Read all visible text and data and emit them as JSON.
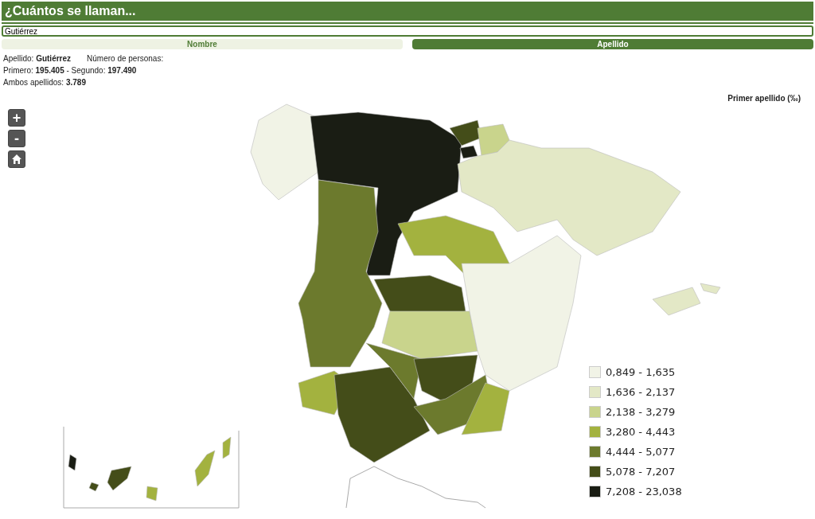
{
  "header": {
    "title": "¿Cuántos se llaman..."
  },
  "search": {
    "value": "Gutiérrez"
  },
  "tabs": [
    {
      "label": "Nombre",
      "selected": false
    },
    {
      "label": "Apellido",
      "selected": true
    }
  ],
  "info": {
    "line_1": "Apellido: **Gutiérrez**",
    "line_1b": "Número de personas:",
    "line_2": "Primero: **195.405** - Segundo: **197.490**",
    "line_3": "Ambos apellidos: **3.789**"
  },
  "map": {
    "title": "Primer apellido (‰)",
    "zoom_in": "+",
    "zoom_out": "-",
    "legend": [
      {
        "label": "0,849 - 1,635",
        "color": "#f1f3e6"
      },
      {
        "label": "1,636 - 2,137",
        "color": "#e3e8c6"
      },
      {
        "label": "2,138 - 3,279",
        "color": "#c9d48c"
      },
      {
        "label": "3,280 - 4,443",
        "color": "#a3b23f"
      },
      {
        "label": "4,444 - 5,077",
        "color": "#6c7a2d"
      },
      {
        "label": "5,078 - 7,207",
        "color": "#444d19"
      },
      {
        "label": "7,208 - 23,038",
        "color": "#1a1d14"
      }
    ]
  }
}
